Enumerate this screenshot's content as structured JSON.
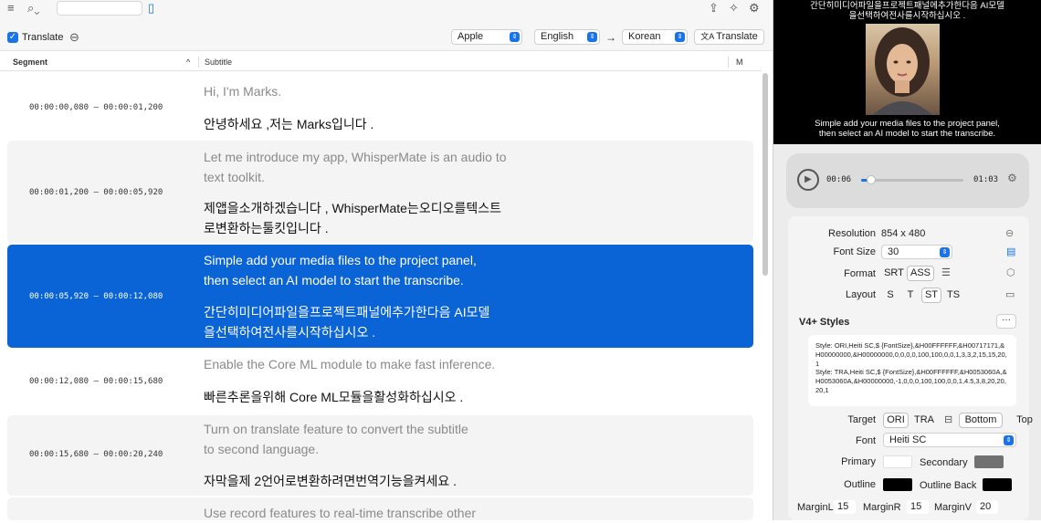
{
  "toolbar": {
    "search_placeholder": "",
    "translate_label": "Translate",
    "engine": "Apple",
    "source_lang": "English",
    "arrow": "→",
    "target_lang": "Korean",
    "translate_button": "Translate"
  },
  "table": {
    "col_segment": "Segment",
    "col_subtitle": "Subtitle",
    "col_m": "M",
    "rows": [
      {
        "time": "00:00:00,080 – 00:00:01,200",
        "orig1": "Hi, I'm Marks.",
        "orig2": "",
        "trans1": "안녕하세요 ,저는 Marks입니다 .",
        "trans2": ""
      },
      {
        "time": "00:00:01,200 – 00:00:05,920",
        "orig1": "Let me introduce my app, WhisperMate is an audio to",
        "orig2": "text toolkit.",
        "trans1": "제앱을소개하겠습니다 , WhisperMate는오디오를텍스트",
        "trans2": "로변환하는툴킷입니다 ."
      },
      {
        "time": "00:00:05,920 – 00:00:12,080",
        "orig1": "Simple add your media files to the project panel,",
        "orig2": "then select an AI model to start the transcribe.",
        "trans1": "간단히미디어파일을프로젝트패널에추가한다음 AI모델",
        "trans2": "을선택하여전사를시작하십시오 ."
      },
      {
        "time": "00:00:12,080 – 00:00:15,680",
        "orig1": "Enable the Core ML module to make fast inference.",
        "orig2": "",
        "trans1": "빠른추론을위해 Core ML모듈을활성화하십시오 .",
        "trans2": ""
      },
      {
        "time": "00:00:15,680 – 00:00:20,240",
        "orig1": "Turn on translate feature to convert the subtitle",
        "orig2": "to second language.",
        "trans1": "자막을제 2언어로변환하려면번역기능을켜세요 .",
        "trans2": ""
      },
      {
        "time": "",
        "orig1": "Use record features to real-time transcribe other",
        "orig2": "",
        "trans1": "",
        "trans2": ""
      }
    ]
  },
  "preview": {
    "top_line1": "간단히미디어파일을프로젝트패널에추가한다음 AI모델",
    "top_line2": "을선택하여전사를시작하십시오 .",
    "bottom_line1": "Simple add your media files to the project panel,",
    "bottom_line2": "then select an AI model to start the transcribe."
  },
  "player": {
    "current": "00:06",
    "total": "01:03",
    "progress": 0.1
  },
  "settings": {
    "resolution_label": "Resolution",
    "resolution_value": "854 x 480",
    "fontsize_label": "Font Size",
    "fontsize_value": "30",
    "format_label": "Format",
    "format_srt": "SRT",
    "format_ass": "ASS",
    "layout_label": "Layout",
    "layout_s": "S",
    "layout_t": "T",
    "layout_st": "ST",
    "layout_ts": "TS",
    "styles_title": "V4+ Styles",
    "styles_more": "···",
    "styles_text": "Style: ORI,Heiti SC,$ {FontSize},&H00FFFFFF,&H00717171,&H00000000,&H00000000,0,0,0,0,100,100,0,0,1,3,3,2,15,15,20,1\nStyle: TRA,Heiti SC,$ {FontSize},&H00FFFFFF,&H0053060A,&H0053060A,&H00000000,-1,0,0,0,100,100,0,0,1,4.5,3,8,20,20,20,1",
    "target_label": "Target",
    "target_ori": "ORI",
    "target_tra": "TRA",
    "pos_bottom": "Bottom",
    "pos_top": "Top",
    "font_label": "Font",
    "font_value": "Heiti SC",
    "primary_label": "Primary",
    "secondary_label": "Secondary",
    "outline_label": "Outline",
    "outline_back_label": "Outline Back",
    "marginl_label": "MarginL",
    "marginl_value": "15",
    "marginr_label": "MarginR",
    "marginr_value": "15",
    "marginv_label": "MarginV",
    "marginv_value": "20"
  },
  "colors": {
    "accent": "#0a64d6",
    "primary": "#ffffff",
    "secondary": "#717171",
    "outline": "#000000",
    "outline_back": "#000000"
  }
}
